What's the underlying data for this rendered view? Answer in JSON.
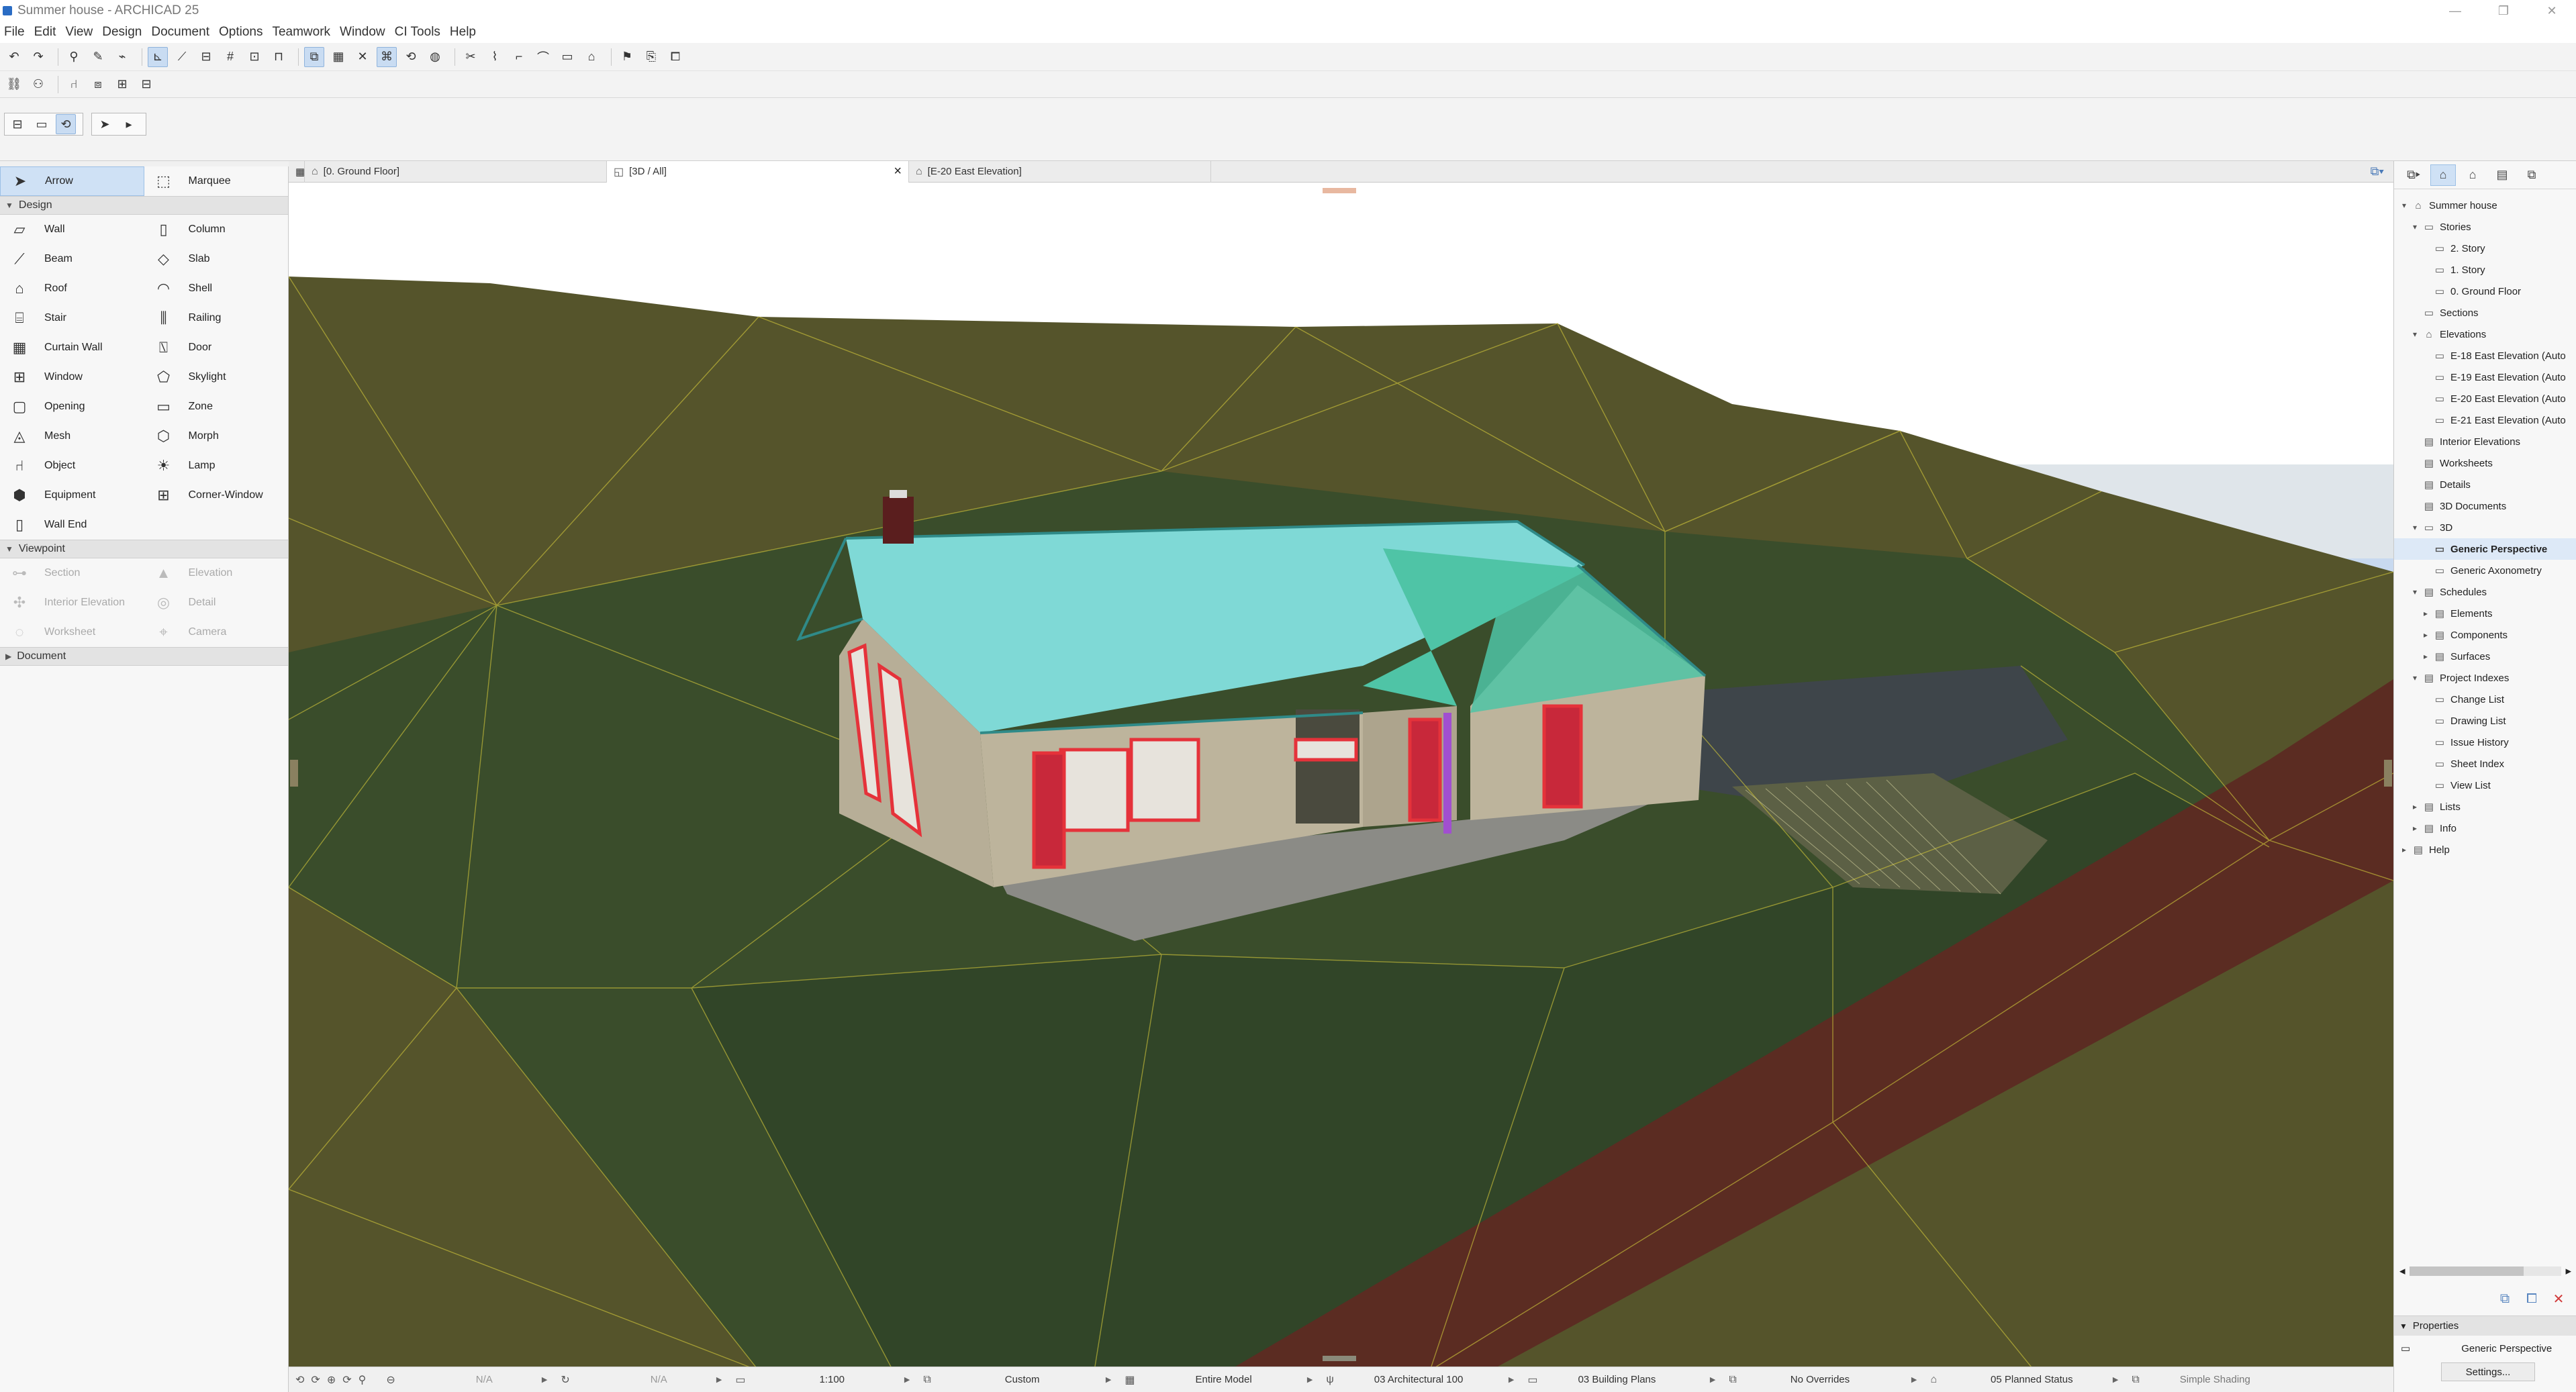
{
  "window": {
    "title": "Summer house - ARCHICAD 25",
    "minimize": "—",
    "restore": "❐",
    "close": "✕"
  },
  "menu": [
    "File",
    "Edit",
    "View",
    "Design",
    "Document",
    "Options",
    "Teamwork",
    "Window",
    "CI Tools",
    "Help"
  ],
  "toolbox": {
    "selection": [
      {
        "label": "Arrow",
        "icon": "arrow-icon"
      },
      {
        "label": "Marquee",
        "icon": "marquee-icon"
      }
    ],
    "design_header": "Design",
    "design_tools": [
      {
        "label": "Wall",
        "icon": "wall-icon"
      },
      {
        "label": "Column",
        "icon": "column-icon"
      },
      {
        "label": "Beam",
        "icon": "beam-icon"
      },
      {
        "label": "Slab",
        "icon": "slab-icon"
      },
      {
        "label": "Roof",
        "icon": "roof-icon"
      },
      {
        "label": "Shell",
        "icon": "shell-icon"
      },
      {
        "label": "Stair",
        "icon": "stair-icon"
      },
      {
        "label": "Railing",
        "icon": "railing-icon"
      },
      {
        "label": "Curtain Wall",
        "icon": "curtain-wall-icon"
      },
      {
        "label": "Door",
        "icon": "door-icon"
      },
      {
        "label": "Window",
        "icon": "window-icon"
      },
      {
        "label": "Skylight",
        "icon": "skylight-icon"
      },
      {
        "label": "Opening",
        "icon": "opening-icon"
      },
      {
        "label": "Zone",
        "icon": "zone-icon"
      },
      {
        "label": "Mesh",
        "icon": "mesh-icon"
      },
      {
        "label": "Morph",
        "icon": "morph-icon"
      },
      {
        "label": "Object",
        "icon": "object-icon"
      },
      {
        "label": "Lamp",
        "icon": "lamp-icon"
      },
      {
        "label": "Equipment",
        "icon": "equipment-icon"
      },
      {
        "label": "Corner-Window",
        "icon": "corner-window-icon"
      },
      {
        "label": "Wall End",
        "icon": "wall-end-icon"
      }
    ],
    "viewpoint_header": "Viewpoint",
    "viewpoint_tools": [
      {
        "label": "Section",
        "icon": "section-icon"
      },
      {
        "label": "Elevation",
        "icon": "elevation-icon"
      },
      {
        "label": "Interior Elevation",
        "icon": "interior-elevation-icon"
      },
      {
        "label": "Detail",
        "icon": "detail-icon"
      },
      {
        "label": "Worksheet",
        "icon": "worksheet-icon"
      },
      {
        "label": "Camera",
        "icon": "camera-icon"
      }
    ],
    "document_header": "Document"
  },
  "tabs": [
    {
      "label": "[0. Ground Floor]"
    },
    {
      "label": "[3D / All]",
      "close": "×"
    },
    {
      "label": "[E-20 East Elevation]"
    }
  ],
  "navigator": {
    "tree": [
      {
        "label": "Summer house",
        "level": 0,
        "arrow": "▾"
      },
      {
        "label": "Stories",
        "level": 1,
        "arrow": "▾"
      },
      {
        "label": "2. Story",
        "level": 2,
        "arrow": ""
      },
      {
        "label": "1. Story",
        "level": 2,
        "arrow": ""
      },
      {
        "label": "0. Ground Floor",
        "level": 2,
        "arrow": ""
      },
      {
        "label": "Sections",
        "level": 1,
        "arrow": ""
      },
      {
        "label": "Elevations",
        "level": 1,
        "arrow": "▾"
      },
      {
        "label": "E-18 East Elevation (Auto",
        "level": 2,
        "arrow": ""
      },
      {
        "label": "E-19 East Elevation (Auto",
        "level": 2,
        "arrow": ""
      },
      {
        "label": "E-20 East Elevation (Auto",
        "level": 2,
        "arrow": ""
      },
      {
        "label": "E-21 East Elevation (Auto",
        "level": 2,
        "arrow": ""
      },
      {
        "label": "Interior Elevations",
        "level": 1,
        "arrow": ""
      },
      {
        "label": "Worksheets",
        "level": 1,
        "arrow": ""
      },
      {
        "label": "Details",
        "level": 1,
        "arrow": ""
      },
      {
        "label": "3D Documents",
        "level": 1,
        "arrow": ""
      },
      {
        "label": "3D",
        "level": 1,
        "arrow": "▾"
      },
      {
        "label": "Generic Perspective",
        "level": 2,
        "arrow": "",
        "selected": true
      },
      {
        "label": "Generic Axonometry",
        "level": 2,
        "arrow": ""
      },
      {
        "label": "Schedules",
        "level": 1,
        "arrow": "▾"
      },
      {
        "label": "Elements",
        "level": 2,
        "arrow": "▸"
      },
      {
        "label": "Components",
        "level": 2,
        "arrow": "▸"
      },
      {
        "label": "Surfaces",
        "level": 2,
        "arrow": "▸"
      },
      {
        "label": "Project Indexes",
        "level": 1,
        "arrow": "▾"
      },
      {
        "label": "Change List",
        "level": 2,
        "arrow": ""
      },
      {
        "label": "Drawing List",
        "level": 2,
        "arrow": ""
      },
      {
        "label": "Issue History",
        "level": 2,
        "arrow": ""
      },
      {
        "label": "Sheet Index",
        "level": 2,
        "arrow": ""
      },
      {
        "label": "View List",
        "level": 2,
        "arrow": ""
      },
      {
        "label": "Lists",
        "level": 1,
        "arrow": "▸"
      },
      {
        "label": "Info",
        "level": 1,
        "arrow": "▸"
      },
      {
        "label": "Help",
        "level": 0,
        "arrow": "▸"
      }
    ],
    "properties_header": "Properties",
    "properties_value": "Generic Perspective",
    "settings_label": "Settings..."
  },
  "statusbar": {
    "angle_x": "N/A",
    "angle_y": "N/A",
    "scale": "1:100",
    "layer_combo": "Custom",
    "model_view": "Entire Model",
    "pen_set": "03 Architectural 100",
    "mvo": "03 Building Plans",
    "graphic_override": "No Overrides",
    "renovation": "05 Planned Status",
    "shading": "Simple Shading"
  },
  "colors": {
    "terrain_dark": "#3f4a24",
    "terrain_light": "#5e5d2e",
    "terrain_green": "#344a27",
    "road": "#5a2a20",
    "roof": "#7fd9d6",
    "wall": "#b9b09a",
    "highlight_red": "#e5323a",
    "mesh_line": "#c7c03a",
    "selection_blue": "#cfe1f5"
  }
}
